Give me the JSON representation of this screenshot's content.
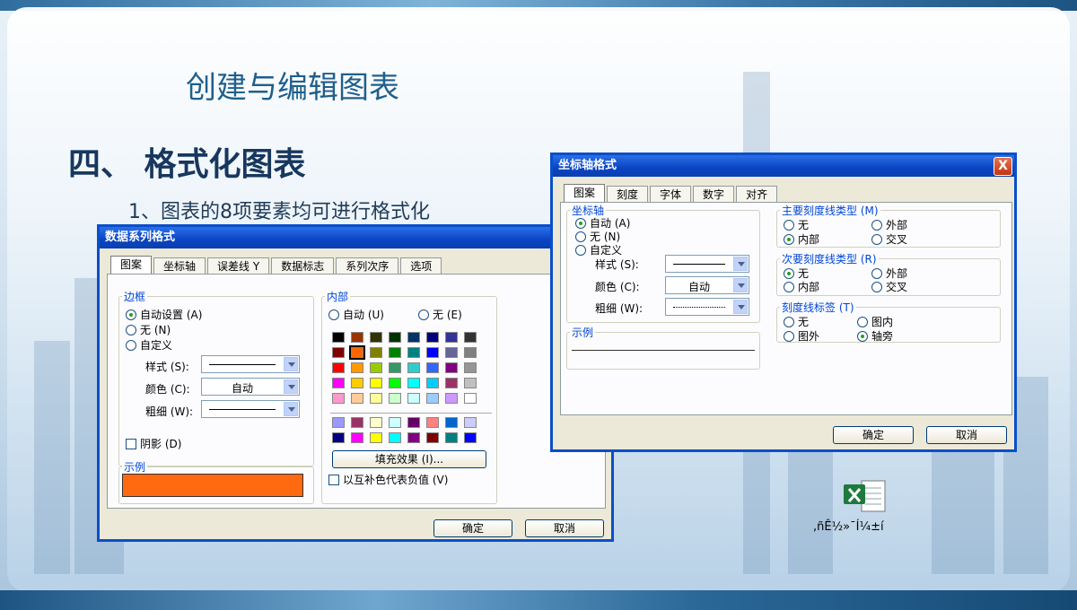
{
  "slide": {
    "title": "创建与编辑图表",
    "heading": "四、 格式化图表",
    "subline": "1、图表的8项要素均可进行格式化",
    "file_label": ",ñÊ½»¯Í¼±í"
  },
  "series_dialog": {
    "title": "数据系列格式",
    "tabs": [
      "图案",
      "坐标轴",
      "误差线 Y",
      "数据标志",
      "系列次序",
      "选项"
    ],
    "border": {
      "legend": "边框",
      "auto": "自动设置 (A)",
      "none": "无 (N)",
      "custom": "自定义",
      "style_label": "样式 (S):",
      "color_label": "颜色 (C):",
      "color_value": "自动",
      "weight_label": "粗细 (W):",
      "shadow": "阴影 (D)"
    },
    "area": {
      "legend": "内部",
      "auto": "自动 (U)",
      "none": "无 (E)",
      "fill_button": "填充效果 (I)...",
      "invert": "以互补色代表负值 (V)"
    },
    "sample_legend": "示例",
    "sample_color": "#ff6a10",
    "ok": "确定",
    "cancel": "取消"
  },
  "axis_dialog": {
    "title": "坐标轴格式",
    "close": "X",
    "tabs": [
      "图案",
      "刻度",
      "字体",
      "数字",
      "对齐"
    ],
    "axis": {
      "legend": "坐标轴",
      "auto": "自动 (A)",
      "none": "无 (N)",
      "custom": "自定义",
      "style_label": "样式 (S):",
      "color_label": "颜色 (C):",
      "color_value": "自动",
      "weight_label": "粗细 (W):"
    },
    "major": {
      "legend": "主要刻度线类型 (M)",
      "none": "无",
      "outside": "外部",
      "inside": "内部",
      "cross": "交叉"
    },
    "minor": {
      "legend": "次要刻度线类型 (R)",
      "none": "无",
      "outside": "外部",
      "inside": "内部",
      "cross": "交叉"
    },
    "ticklabels": {
      "legend": "刻度线标签 (T)",
      "none": "无",
      "high": "图内",
      "low": "图外",
      "next": "轴旁"
    },
    "sample_legend": "示例",
    "ok": "确定",
    "cancel": "取消"
  },
  "palette": [
    [
      "#000000",
      "#993300",
      "#333300",
      "#003300",
      "#003366",
      "#000080",
      "#333399",
      "#333333"
    ],
    [
      "#800000",
      "#ff6600",
      "#808000",
      "#008000",
      "#008080",
      "#0000ff",
      "#666699",
      "#808080"
    ],
    [
      "#ff0000",
      "#ff9900",
      "#99cc00",
      "#339966",
      "#33cccc",
      "#3366ff",
      "#800080",
      "#969696"
    ],
    [
      "#ff00ff",
      "#ffcc00",
      "#ffff00",
      "#00ff00",
      "#00ffff",
      "#00ccff",
      "#993366",
      "#c0c0c0"
    ],
    [
      "#ff99cc",
      "#ffcc99",
      "#ffff99",
      "#ccffcc",
      "#ccffff",
      "#99ccff",
      "#cc99ff",
      "#ffffff"
    ],
    [
      "#9999ff",
      "#993366",
      "#ffffcc",
      "#ccffff",
      "#660066",
      "#ff8080",
      "#0066cc",
      "#ccccff"
    ],
    [
      "#000080",
      "#ff00ff",
      "#ffff00",
      "#00ffff",
      "#800080",
      "#800000",
      "#008080",
      "#0000ff"
    ]
  ]
}
